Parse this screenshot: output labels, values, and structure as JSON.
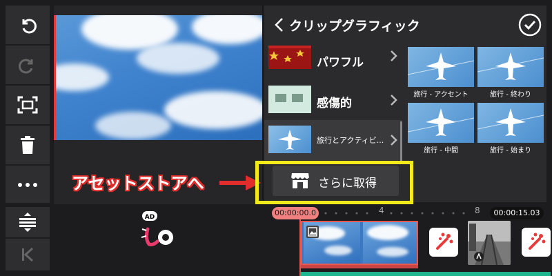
{
  "toolbar": {
    "items": [
      {
        "name": "undo-button",
        "icon": "undo-icon",
        "enabled": true
      },
      {
        "name": "redo-button",
        "icon": "redo-icon",
        "enabled": false
      },
      {
        "name": "fit-screen-button",
        "icon": "fit-screen-icon",
        "enabled": true
      },
      {
        "name": "delete-button",
        "icon": "trash-icon",
        "enabled": true
      },
      {
        "name": "more-button",
        "icon": "more-horizontal-icon",
        "enabled": true
      },
      {
        "name": "track-adjust-button",
        "icon": "adjust-height-icon",
        "enabled": true
      },
      {
        "name": "jump-start-button",
        "icon": "skip-to-start-icon",
        "enabled": false
      }
    ]
  },
  "panel": {
    "title": "クリップグラフィック",
    "categories": [
      {
        "label": "パワフル"
      },
      {
        "label": "感傷的"
      },
      {
        "label": "旅行とアクティビ..."
      }
    ],
    "grid": [
      {
        "label": "旅行 - アクセント"
      },
      {
        "label": "旅行 - 終わり"
      },
      {
        "label": "旅行 - 中間"
      },
      {
        "label": "旅行 - 始まり"
      }
    ],
    "get_more_label": "さらに取得"
  },
  "annotation": {
    "text": "アセットストアへ",
    "color": "#e22d2d",
    "highlight_color": "#f2ea1a"
  },
  "timeline": {
    "start_time": "00:00:00.0",
    "end_time": "00:00:15.03",
    "tick_labels": [
      "4",
      "8"
    ],
    "ad_badge": "AD"
  },
  "colors": {
    "accent": "#e8584f",
    "panel_bg": "#2b2b2d",
    "toolbar_bg": "#2e2e30"
  }
}
